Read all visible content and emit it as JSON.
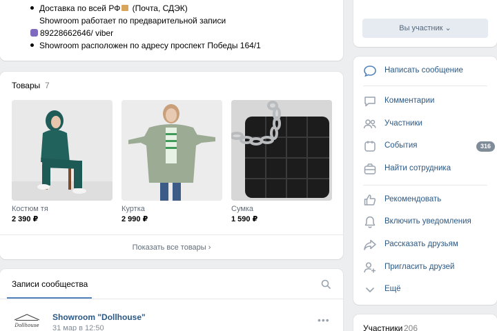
{
  "info": {
    "lines": [
      {
        "text_a": "Доставка по всей РФ",
        "text_b": " (Почта, СДЭК)"
      },
      {
        "text": "Showroom работает по предварительной записи"
      },
      {
        "text": "89228662646/ viber"
      },
      {
        "text": "Showroom расположен по адресу проспект Победы 164/1"
      }
    ]
  },
  "goods": {
    "title": "Товары",
    "count": "7",
    "items": [
      {
        "name": "Костюм тя",
        "price": "2 390 ₽",
        "icon": "photo-green-tracksuit"
      },
      {
        "name": "Куртка",
        "price": "2 990 ₽",
        "icon": "photo-quilted-jacket"
      },
      {
        "name": "Сумка",
        "price": "1 590 ₽",
        "icon": "photo-black-bag"
      }
    ],
    "show_all": "Показать все товары ›"
  },
  "posts": {
    "tab": "Записи сообщества",
    "author": "Showroom \"Dollhouse\"",
    "date": "31 мар в 12:50",
    "more": "•••"
  },
  "sidebar": {
    "member_button": "Вы участник ⌄",
    "actions": [
      {
        "label": "Написать сообщение",
        "icon": "message-icon"
      },
      {
        "label": "Комментарии",
        "icon": "comment-icon"
      },
      {
        "label": "Участники",
        "icon": "users-icon"
      },
      {
        "label": "События",
        "icon": "event-icon",
        "badge": "316"
      },
      {
        "label": "Найти сотрудника",
        "icon": "briefcase-icon"
      },
      {
        "label": "Рекомендовать",
        "icon": "like-icon"
      },
      {
        "label": "Включить уведомления",
        "icon": "bell-icon"
      },
      {
        "label": "Рассказать друзьям",
        "icon": "share-icon"
      },
      {
        "label": "Пригласить друзей",
        "icon": "add-user-icon"
      },
      {
        "label": "Ещё",
        "icon": "chevron-down-icon"
      }
    ],
    "participants_title": "Участники",
    "participants_count": "206"
  },
  "colors": {
    "link": "#2a5885",
    "accent": "#5181b8",
    "background": "#edeef0",
    "badge": "#818c99"
  }
}
